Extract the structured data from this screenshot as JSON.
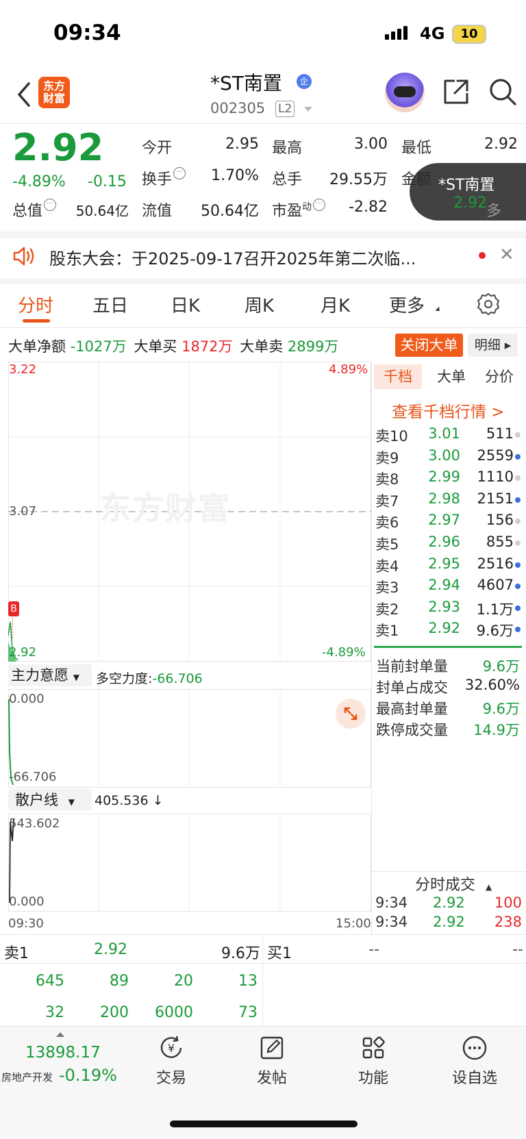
{
  "status": {
    "time": "09:34",
    "network": "4G",
    "battery": "10"
  },
  "header": {
    "logo": "东方\n财富",
    "name": "*ST南置",
    "verified_badge": "企",
    "code": "002305",
    "level": "L2"
  },
  "quote": {
    "price": "2.92",
    "pct": "-4.89%",
    "change": "-0.15",
    "fields": {
      "open_label": "今开",
      "open": "2.95",
      "high_label": "最高",
      "high": "3.00",
      "low_label": "最低",
      "low": "2.92",
      "turnover_label": "换手",
      "turnover": "1.70%",
      "volume_label": "总手",
      "volume": "29.55万",
      "amount_label": "金额",
      "mktcap_label": "总值",
      "mktcap": "50.64亿",
      "float_label": "流值",
      "float": "50.64亿",
      "pe_label": "市盈",
      "pe_sup": "动",
      "pe": "-2.82",
      "more": "多"
    },
    "floating_card": {
      "name": "*ST南置",
      "price": "2.92"
    }
  },
  "notice": {
    "text": "股东大会：于2025-09-17召开2025年第二次临..."
  },
  "tabs": [
    "分时",
    "五日",
    "日K",
    "周K",
    "月K",
    "更多"
  ],
  "big_order": {
    "net_label": "大单净额",
    "net": "-1027万",
    "buy_label": "大单买",
    "buy": "1872万",
    "sell_label": "大单卖",
    "sell": "2899万",
    "close_btn": "关闭大单",
    "detail_btn": "明细"
  },
  "main_chart": {
    "top_price": "3.22",
    "top_pct": "4.89%",
    "mid_price": "3.07",
    "bottom_price": "2.92",
    "bottom_pct": "-4.89%",
    "badge": "B",
    "watermark": "东方财富"
  },
  "sub1": {
    "dropdown": "主力意愿",
    "metric_label": "多空力度:",
    "metric_value": "-66.706",
    "top": "0.000",
    "bottom": "-66.706"
  },
  "sub2": {
    "dropdown": "散户线",
    "value": "405.536",
    "arrow": "↓",
    "top": "543.602",
    "bottom": "0.000"
  },
  "time_axis": {
    "start": "09:30",
    "end": "15:00"
  },
  "orderbook": {
    "tabs": [
      "千档",
      "大单",
      "分价"
    ],
    "link": "查看千档行情 >",
    "rows": [
      {
        "label": "卖10",
        "price": "3.01",
        "vol": "511",
        "dot": "#cfcfcf"
      },
      {
        "label": "卖9",
        "price": "3.00",
        "vol": "2559",
        "dot": "#3a6fd8"
      },
      {
        "label": "卖8",
        "price": "2.99",
        "vol": "1110",
        "dot": "#cfcfcf"
      },
      {
        "label": "卖7",
        "price": "2.98",
        "vol": "2151",
        "dot": "#3a6fd8"
      },
      {
        "label": "卖6",
        "price": "2.97",
        "vol": "156",
        "dot": "#cfcfcf"
      },
      {
        "label": "卖5",
        "price": "2.96",
        "vol": "855",
        "dot": "#cfcfcf"
      },
      {
        "label": "卖4",
        "price": "2.95",
        "vol": "2516",
        "dot": "#3a6fd8"
      },
      {
        "label": "卖3",
        "price": "2.94",
        "vol": "4607",
        "dot": "#3a6fd8"
      },
      {
        "label": "卖2",
        "price": "2.93",
        "vol": "1.1万",
        "dot": "#3a6fd8"
      },
      {
        "label": "卖1",
        "price": "2.92",
        "vol": "9.6万",
        "dot": "#3a6fd8"
      }
    ],
    "seal": [
      {
        "label": "当前封单量",
        "value": "9.6万"
      },
      {
        "label": "封单占成交",
        "value": "32.60%"
      },
      {
        "label": "最高封单量",
        "value": "9.6万"
      },
      {
        "label": "跌停成交量",
        "value": "14.9万"
      }
    ],
    "ticks_header": "分时成交",
    "ticks": [
      {
        "time": "9:34",
        "price": "2.92",
        "vol": "100"
      },
      {
        "time": "9:34",
        "price": "2.92",
        "vol": "238"
      }
    ]
  },
  "bottom_quote": {
    "sell1_label": "卖1",
    "sell1_price": "2.92",
    "sell1_vol": "9.6万",
    "buy1_label": "买1",
    "buy1_price": "--",
    "buy1_vol": "--",
    "row1": [
      "645",
      "89",
      "20",
      "13"
    ],
    "row2": [
      "32",
      "200",
      "6000",
      "73"
    ]
  },
  "nav": {
    "index_value": "13898.17",
    "index_name": "房地产开发",
    "index_pct": "-0.19%",
    "items": [
      "交易",
      "发帖",
      "功能",
      "设自选"
    ]
  },
  "colors": {
    "down": "#1a9a3a",
    "up": "#e8262b",
    "accent": "#e85418"
  }
}
